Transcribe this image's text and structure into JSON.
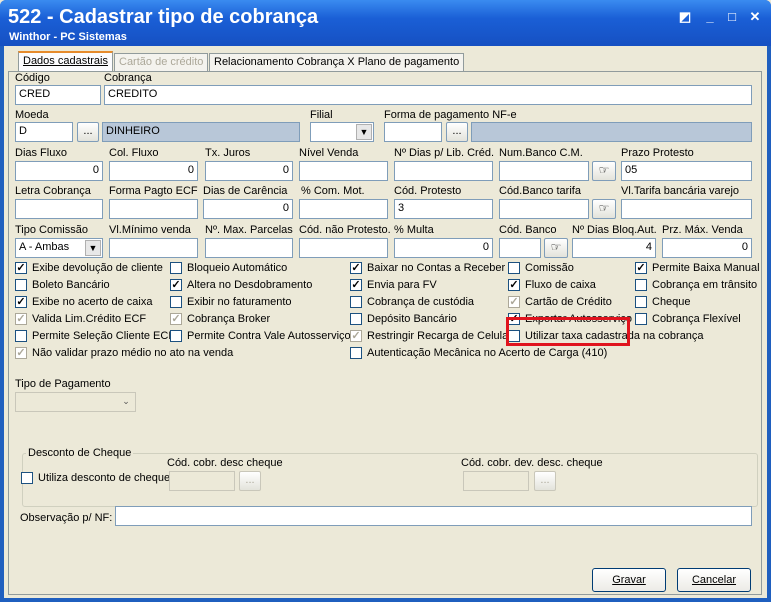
{
  "window": {
    "title": "522 - Cadastrar tipo de cobrança",
    "subtitle": "Winthor - PC Sistemas",
    "controls": [
      "◩",
      "_",
      "□",
      "✕"
    ]
  },
  "tabs": [
    "Dados cadastrais",
    "Cartão de crédito",
    "Relacionamento Cobrança X Plano de pagamento"
  ],
  "labels": {
    "codigo": "Código",
    "cobranca": "Cobrança",
    "moeda": "Moeda",
    "filial": "Filial",
    "forma_pag_nfe": "Forma de pagamento NF-e",
    "dias_fluxo": "Dias Fluxo",
    "col_fluxo": "Col. Fluxo",
    "tx_juros": "Tx. Juros",
    "nivel_venda": "Nível Venda",
    "dias_lib_cred": "Nº Dias p/ Lib. Créd.",
    "num_banco_cm": "Num.Banco C.M.",
    "prazo_protesto": "Prazo Protesto",
    "letra_cobranca": "Letra Cobrança",
    "forma_pagto_ecf": "Forma Pagto ECF",
    "dias_carencia": "Dias de Carência",
    "com_mot": "% Com. Mot.",
    "cod_protesto": "Cód. Protesto",
    "cod_banco_tarifa": "Cód.Banco tarifa",
    "vl_tarifa": "Vl.Tarifa bancária varejo",
    "tipo_comissao": "Tipo Comissão",
    "vl_minimo_venda": "Vl.Mínimo venda",
    "max_parcelas": "Nº. Max. Parcelas",
    "cod_nao_protesto": "Cód. não Protesto.",
    "multa": "% Multa",
    "cod_banco": "Cód. Banco",
    "dias_bloq_aut": "Nº Dias Bloq.Aut.",
    "prz_max_venda": "Prz. Máx. Venda",
    "tipo_pagamento": "Tipo de Pagamento",
    "desconto_cheque": "Desconto de Cheque",
    "cod_cobr_desc_cheque": "Cód. cobr. desc cheque",
    "cod_cobr_dev_desc_cheque": "Cód. cobr. dev. desc. cheque",
    "observacao": "Observação p/ NF:"
  },
  "values": {
    "codigo": "CRED",
    "cobranca": "CREDITO",
    "moeda": "D",
    "moeda_desc": "DINHEIRO",
    "dias_fluxo": "0",
    "col_fluxo": "0",
    "tx_juros": "0",
    "prazo_protesto": "05",
    "dias_carencia": "0",
    "cod_protesto": "3",
    "tipo_comissao": "A - Ambas",
    "multa": "0",
    "dias_bloq_aut": "4",
    "prz_max_venda": "0"
  },
  "dots": "...",
  "checkboxes": [
    {
      "label": "Exibe devolução de cliente",
      "checked": true,
      "gray": false
    },
    {
      "label": "Boleto Bancário",
      "checked": false,
      "gray": false
    },
    {
      "label": "Exibe no acerto de caixa",
      "checked": true,
      "gray": false
    },
    {
      "label": "Valida Lim.Crédito ECF",
      "checked": true,
      "gray": true
    },
    {
      "label": "Permite Seleção Cliente ECF",
      "checked": false,
      "gray": false
    },
    {
      "label": "Não validar prazo médio no ato na venda",
      "checked": true,
      "gray": true
    },
    {
      "label": "Bloqueio Automático",
      "checked": false,
      "gray": false
    },
    {
      "label": "Altera no Desdobramento",
      "checked": true,
      "gray": false
    },
    {
      "label": "Exibir no faturamento",
      "checked": false,
      "gray": false
    },
    {
      "label": "Cobrança Broker",
      "checked": true,
      "gray": true
    },
    {
      "label": "Permite Contra Vale Autosserviço",
      "checked": false,
      "gray": false
    },
    {
      "label": "Autenticação Mecânica no Acerto de Carga (410)",
      "checked": false,
      "gray": false
    },
    {
      "label": "Baixar no Contas a Receber",
      "checked": true,
      "gray": false
    },
    {
      "label": "Envia para FV",
      "checked": true,
      "gray": false
    },
    {
      "label": "Cobrança de custódia",
      "checked": false,
      "gray": false
    },
    {
      "label": "Depósito Bancário",
      "checked": false,
      "gray": false
    },
    {
      "label": "Restringir Recarga de Celular",
      "checked": true,
      "gray": true
    },
    {
      "label": "Comissão",
      "checked": false,
      "gray": false
    },
    {
      "label": "Fluxo de caixa",
      "checked": true,
      "gray": false
    },
    {
      "label": "Cartão de Crédito",
      "checked": true,
      "gray": true
    },
    {
      "label": "Exportar Autosserviço",
      "checked": true,
      "gray": false
    },
    {
      "label": "Utilizar taxa cadastrada na cobrança",
      "checked": false,
      "gray": false
    },
    {
      "label": "Permite Baixa Manual",
      "checked": true,
      "gray": false
    },
    {
      "label": "Cobrança em trânsito",
      "checked": false,
      "gray": false
    },
    {
      "label": "Cheque",
      "checked": false,
      "gray": false
    },
    {
      "label": "Cobrança Flexível",
      "checked": false,
      "gray": false
    }
  ],
  "utiliza_desconto": {
    "label": "Utiliza desconto de cheque",
    "checked": false
  },
  "buttons": {
    "gravar": "Gravar",
    "cancelar": "Cancelar"
  }
}
